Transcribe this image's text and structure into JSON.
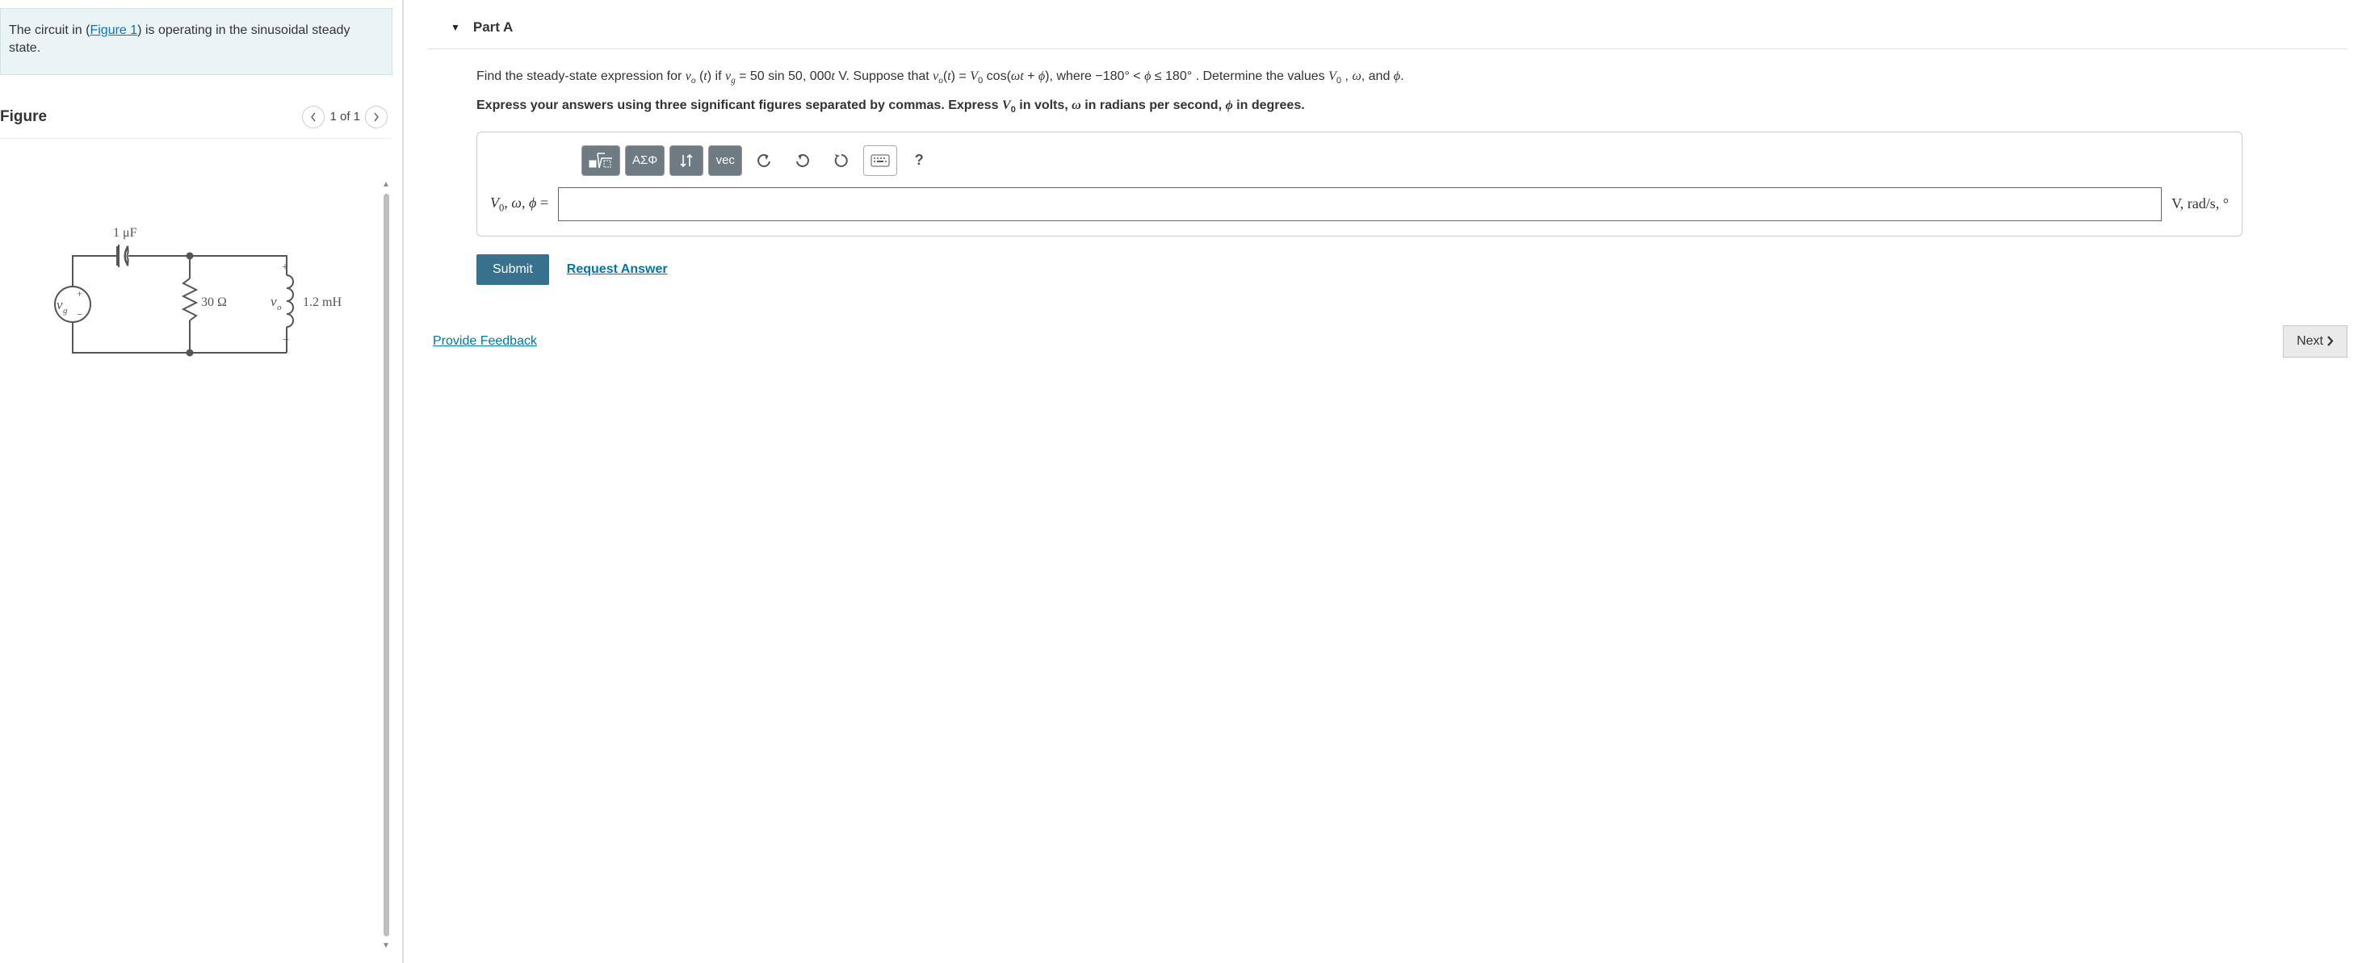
{
  "intro": {
    "prefix": "The circuit in (",
    "link": "Figure 1",
    "suffix": ") is operating in the sinusoidal steady state."
  },
  "figure": {
    "heading": "Figure",
    "pager": "1 of 1",
    "labels": {
      "cap": "1 μF",
      "res": "30 Ω",
      "ind": "1.2 mH",
      "vg": "v",
      "vg_sub": "g",
      "vo": "v",
      "vo_sub": "o",
      "plus": "+",
      "minus": "−"
    }
  },
  "part": {
    "title": "Part A"
  },
  "problem": {
    "line1_html": "Find the steady-state expression for <span class='mi'>v<span class='sub'>o</span></span> (<span class='mi'>t</span>) if <span class='mi'>v<span class='sub'>g</span></span> = 50 sin 50, 000<span class='mi'>t</span> V. Suppose that <span class='mi'>v<span class='sub'>o</span></span>(<span class='mi'>t</span>) = <span class='mi'>V</span><span class='sub'>0</span> cos(<span class='mi'>ωt</span> + <span class='mi'>ϕ</span>), where −180° &lt; <span class='mi'>ϕ</span> ≤ 180° . Determine the values <span class='mi'>V</span><span class='sub'>0</span> , <span class='mi'>ω</span>, and <span class='mi'>ϕ</span>.",
    "instr_html": "Express your answers using three significant figures separated by commas. Express <span class='mi'>V</span><span class='sub'>0</span> in volts, <span class='mi'>ω</span> in radians per second, <span class='mi'>ϕ</span> in degrees."
  },
  "answer": {
    "lhs_html": "<span class='mi'>V</span><span class='sub'>0</span>, <span class='mi'>ω</span>, <span class='mi'>ϕ</span> =",
    "value": "",
    "rhs_html": "V, rad/s, °"
  },
  "toolbar": {
    "templates": "x√",
    "greek": "ΑΣΦ",
    "subsup": "↓↑",
    "vec": "vec",
    "undo": "↶",
    "redo": "↷",
    "reset": "↻",
    "keyboard": "⌨",
    "help": "?"
  },
  "buttons": {
    "submit": "Submit",
    "request": "Request Answer",
    "feedback": "Provide Feedback",
    "next": "Next"
  }
}
